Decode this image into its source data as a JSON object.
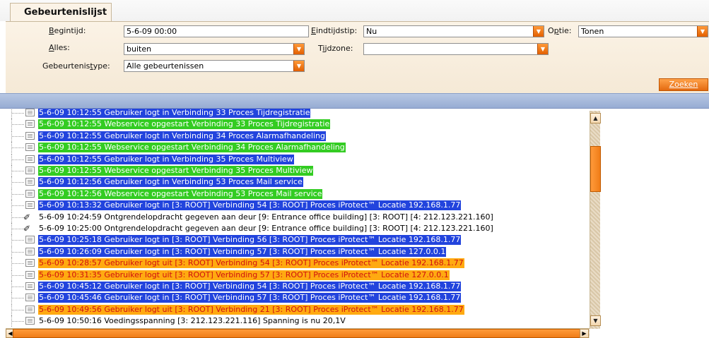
{
  "tab": {
    "title": "Gebeurtenislijst"
  },
  "filters": {
    "begintijd": {
      "label_pre": "",
      "label_u": "B",
      "label_post": "egintijd:",
      "value": "5-6-09 00:00"
    },
    "eindtijdstip": {
      "label_pre": "",
      "label_u": "E",
      "label_post": "indtijdstip:",
      "value": "Nu"
    },
    "optie": {
      "label_pre": "O",
      "label_u": "p",
      "label_post": "tie:",
      "value": "Tonen"
    },
    "alles": {
      "label_pre": "",
      "label_u": "A",
      "label_post": "lles:",
      "value": "buiten"
    },
    "tijdzone": {
      "label_pre": "T",
      "label_u": "i",
      "label_post": "jdzone:",
      "value": ""
    },
    "gebeurtenistype": {
      "label_pre": "Gebeurtenis",
      "label_u": "t",
      "label_post": "ype:",
      "value": "Alle gebeurtenissen"
    }
  },
  "search_button": {
    "label": "Zoeken"
  },
  "colors": {
    "blue": "#2244dd",
    "green": "#33cc22",
    "orange": "#ffaa11",
    "orange_text": "#d01010",
    "accent": "#f07d18"
  },
  "log_rows": [
    {
      "style": "blue",
      "icon": "document-icon",
      "text": "5-6-09 10:12:55 Gebruiker logt in Verbinding 33 Proces Tijdregistratie"
    },
    {
      "style": "green",
      "icon": "document-icon",
      "text": "5-6-09 10:12:55 Webservice opgestart Verbinding 33 Proces Tijdregistratie"
    },
    {
      "style": "blue",
      "icon": "document-icon",
      "text": "5-6-09 10:12:55 Gebruiker logt in Verbinding 34 Proces Alarmafhandeling"
    },
    {
      "style": "green",
      "icon": "document-icon",
      "text": "5-6-09 10:12:55 Webservice opgestart Verbinding 34 Proces Alarmafhandeling"
    },
    {
      "style": "blue",
      "icon": "document-icon",
      "text": "5-6-09 10:12:55 Gebruiker logt in Verbinding 35 Proces Multiview"
    },
    {
      "style": "green",
      "icon": "document-icon",
      "text": "5-6-09 10:12:55 Webservice opgestart Verbinding 35 Proces Multiview"
    },
    {
      "style": "blue",
      "icon": "document-icon",
      "text": "5-6-09 10:12:56 Gebruiker logt in Verbinding 53 Proces Mail service"
    },
    {
      "style": "green",
      "icon": "document-icon",
      "text": "5-6-09 10:12:56 Webservice opgestart Verbinding 53 Proces Mail service"
    },
    {
      "style": "blue",
      "icon": "document-icon",
      "text": "5-6-09 10:13:32 Gebruiker logt in [3: ROOT] Verbinding 54 [3: ROOT] Proces iProtect™ Locatie 192.168.1.77"
    },
    {
      "style": "plain",
      "icon": "key-icon",
      "text": "5-6-09 10:24:59 Ontgrendelopdracht gegeven aan deur [9: Entrance office building] [3: ROOT] [4: 212.123.221.160]"
    },
    {
      "style": "plain",
      "icon": "key-icon",
      "text": "5-6-09 10:25:00 Ontgrendelopdracht gegeven aan deur [9: Entrance office building] [3: ROOT] [4: 212.123.221.160]"
    },
    {
      "style": "blue",
      "icon": "document-icon",
      "text": "5-6-09 10:25:18 Gebruiker logt in [3: ROOT] Verbinding 56 [3: ROOT] Proces iProtect™ Locatie 192.168.1.77"
    },
    {
      "style": "blue",
      "icon": "document-icon",
      "text": "5-6-09 10:26:09 Gebruiker logt in [3: ROOT] Verbinding 57 [3: ROOT] Proces iProtect™ Locatie 127.0.0.1"
    },
    {
      "style": "orange",
      "icon": "document-icon",
      "text": "5-6-09 10:28:57 Gebruiker logt uit [3: ROOT] Verbinding 54 [3: ROOT] Proces iProtect™ Locatie 192.168.1.77"
    },
    {
      "style": "orange",
      "icon": "document-icon",
      "text": "5-6-09 10:31:35 Gebruiker logt uit [3: ROOT] Verbinding 57 [3: ROOT] Proces iProtect™ Locatie 127.0.0.1"
    },
    {
      "style": "blue",
      "icon": "document-icon",
      "text": "5-6-09 10:45:12 Gebruiker logt in [3: ROOT] Verbinding 54 [3: ROOT] Proces iProtect™ Locatie 192.168.1.77"
    },
    {
      "style": "blue",
      "icon": "document-icon",
      "text": "5-6-09 10:45:46 Gebruiker logt in [3: ROOT] Verbinding 57 [3: ROOT] Proces iProtect™ Locatie 192.168.1.77"
    },
    {
      "style": "orange",
      "icon": "document-icon",
      "text": "5-6-09 10:49:56 Gebruiker logt uit [3: ROOT] Verbinding 21 [3: ROOT] Proces iProtect™ Locatie 192.168.1.77"
    },
    {
      "style": "plain",
      "icon": "document-icon",
      "text": "5-6-09 10:50:16 Voedingsspanning [3: 212.123.221.116] Spanning is nu 20,1V"
    }
  ]
}
